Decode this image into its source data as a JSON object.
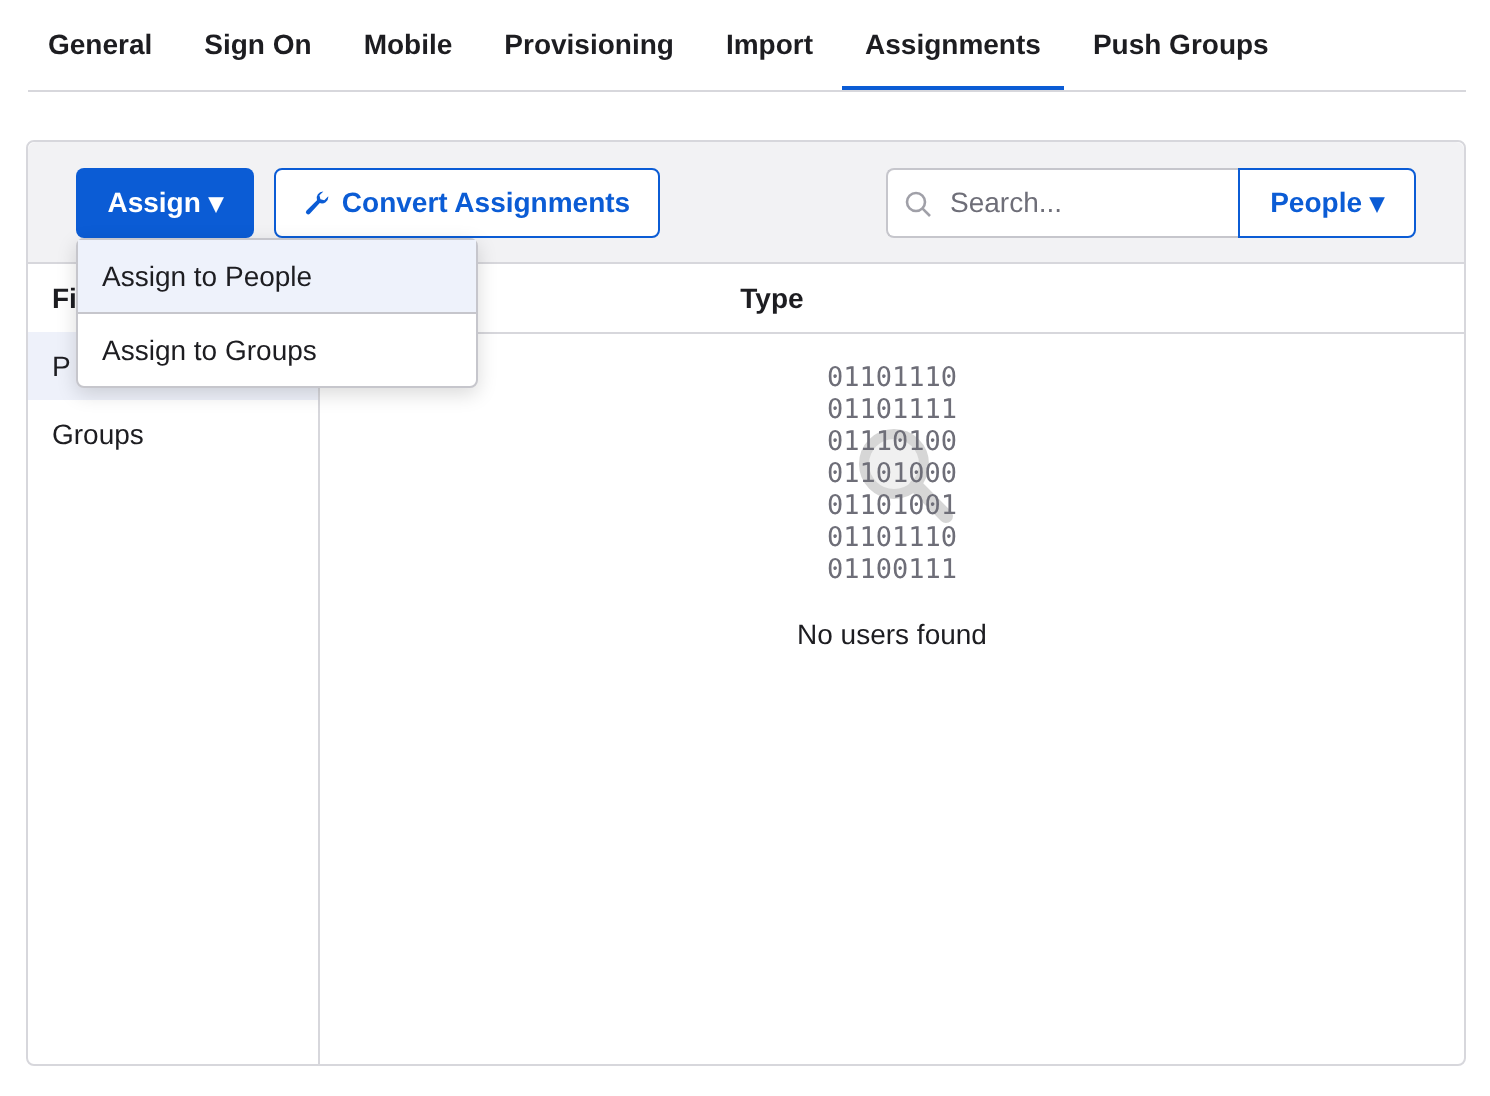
{
  "tabs": [
    {
      "label": "General",
      "selected": false
    },
    {
      "label": "Sign On",
      "selected": false
    },
    {
      "label": "Mobile",
      "selected": false
    },
    {
      "label": "Provisioning",
      "selected": false
    },
    {
      "label": "Import",
      "selected": false
    },
    {
      "label": "Assignments",
      "selected": true
    },
    {
      "label": "Push Groups",
      "selected": false
    }
  ],
  "toolbar": {
    "assign_button": "Assign ▾",
    "convert_button": "Convert Assignments",
    "search": {
      "placeholder": "Search..."
    },
    "filter_button": "People ▾"
  },
  "assign_menu": [
    {
      "label": "Assign to People",
      "selected": true
    },
    {
      "label": "Assign to Groups",
      "selected": false
    }
  ],
  "sidebar": {
    "heading": "Fi",
    "items": [
      {
        "label": "P",
        "selected": true
      },
      {
        "label": "Groups",
        "selected": false
      }
    ]
  },
  "table": {
    "columns": [
      "Type"
    ]
  },
  "empty_state": {
    "binary_lines": [
      "01101110",
      "01101111",
      "01110100",
      "01101000",
      "01101001",
      "01101110",
      "01100111"
    ],
    "message": "No users found"
  }
}
